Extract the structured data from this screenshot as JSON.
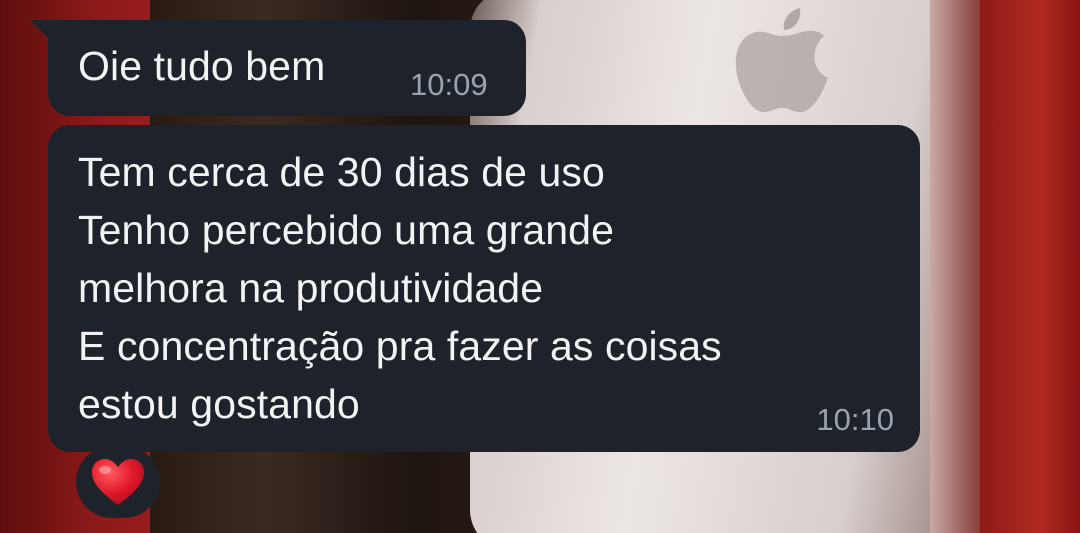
{
  "messages": [
    {
      "text": "Oie tudo bem",
      "time": "10:09"
    },
    {
      "text": "Tem cerca de 30 dias de uso\nTenho percebido uma grande\nmelhora na produtividade\nE concentração pra fazer as coisas\nestou gostando",
      "time": "10:10"
    }
  ],
  "reaction": {
    "icon": "red-heart-icon"
  },
  "colors": {
    "bubble": "#1e232b",
    "text": "#f2f3f5",
    "timestamp": "#9aa2ad",
    "heart": "#e0182a"
  }
}
